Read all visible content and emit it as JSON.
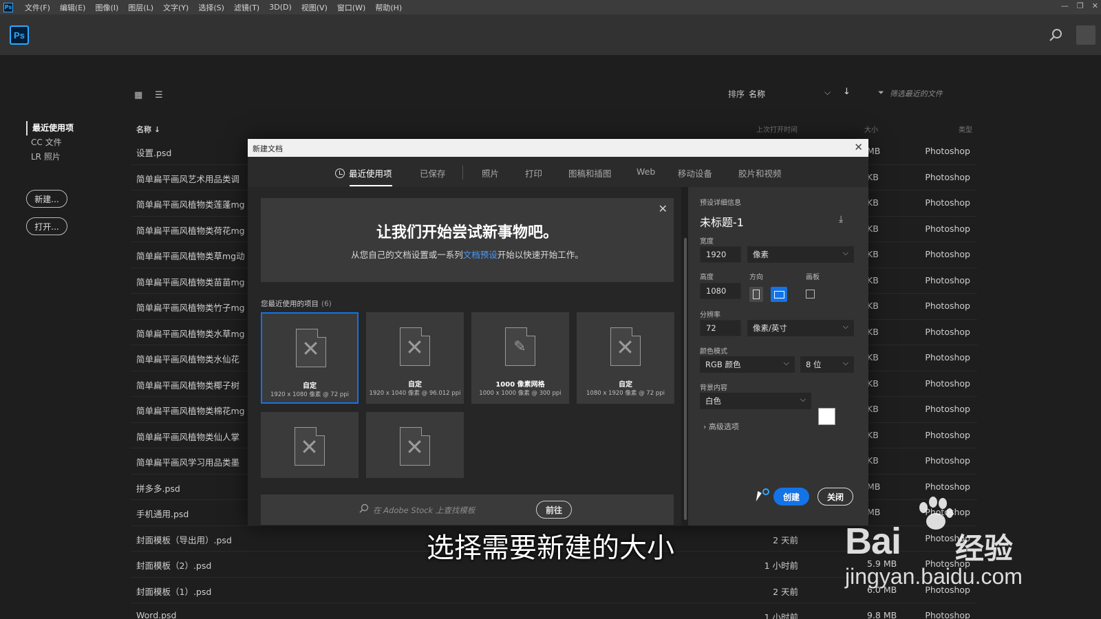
{
  "menubar": {
    "ps_badge": "Ps",
    "items": [
      "文件(F)",
      "编辑(E)",
      "图像(I)",
      "图层(L)",
      "文字(Y)",
      "选择(S)",
      "滤镜(T)",
      "3D(D)",
      "视图(V)",
      "窗口(W)",
      "帮助(H)"
    ],
    "window_controls": [
      "—",
      "❐",
      "✕"
    ]
  },
  "header": {
    "logo": "Ps",
    "search_icon": "search-icon"
  },
  "sidebar": {
    "nav": [
      "最近使用项",
      "CC 文件",
      "LR 照片"
    ],
    "new_button": "新建...",
    "open_button": "打开..."
  },
  "toolbar": {
    "grid_view_icon": "▦",
    "list_view_icon": "☰",
    "sort_label": "排序",
    "sort_value": "名称",
    "sort_chevron": "⌵",
    "sort_direction": "↓",
    "filter_icon": "⏷",
    "filter_placeholder": "筛选最近的文件"
  },
  "columns": {
    "name": "名称 ↓",
    "last_opened": "上次打开时间",
    "size": "大小",
    "type": "类型"
  },
  "files": [
    {
      "name": "设置.psd",
      "time": "",
      "size": "MB",
      "type": "Photoshop"
    },
    {
      "name": "简单扁平画风艺术用品类调",
      "time": "",
      "size": "KB",
      "type": "Photoshop"
    },
    {
      "name": "简单扁平画风植物类莲蓬mg",
      "time": "",
      "size": "KB",
      "type": "Photoshop"
    },
    {
      "name": "简单扁平画风植物类荷花mg",
      "time": "",
      "size": "KB",
      "type": "Photoshop"
    },
    {
      "name": "简单扁平画风植物类草mg动",
      "time": "",
      "size": "KB",
      "type": "Photoshop"
    },
    {
      "name": "简单扁平画风植物类苗苗mg",
      "time": "",
      "size": "KB",
      "type": "Photoshop"
    },
    {
      "name": "简单扁平画风植物类竹子mg",
      "time": "",
      "size": "KB",
      "type": "Photoshop"
    },
    {
      "name": "简单扁平画风植物类水草mg",
      "time": "",
      "size": "KB",
      "type": "Photoshop"
    },
    {
      "name": "简单扁平画风植物类水仙花",
      "time": "",
      "size": "KB",
      "type": "Photoshop"
    },
    {
      "name": "简单扁平画风植物类椰子树",
      "time": "",
      "size": "KB",
      "type": "Photoshop"
    },
    {
      "name": "简单扁平画风植物类棉花mg",
      "time": "",
      "size": "KB",
      "type": "Photoshop"
    },
    {
      "name": "简单扁平画风植物类仙人掌",
      "time": "",
      "size": "KB",
      "type": "Photoshop"
    },
    {
      "name": "简单扁平画风学习用品类墨",
      "time": "",
      "size": "KB",
      "type": "Photoshop"
    },
    {
      "name": "拼多多.psd",
      "time": "",
      "size": "MB",
      "type": "Photoshop"
    },
    {
      "name": "手机通用.psd",
      "time": "",
      "size": "MB",
      "type": "Photoshop"
    },
    {
      "name": "封面模板（导出用）.psd",
      "time": "2 天前",
      "size": "",
      "type": "Photoshop"
    },
    {
      "name": "封面模板（2）.psd",
      "time": "1 小时前",
      "size": "5.9 MB",
      "type": "Photoshop"
    },
    {
      "name": "封面模板（1）.psd",
      "time": "2 天前",
      "size": "6.0 MB",
      "type": "Photoshop"
    },
    {
      "name": "Word.psd",
      "time": "1 小时前",
      "size": "9.8 MB",
      "type": "Photoshop"
    }
  ],
  "modal": {
    "title": "新建文档",
    "close": "✕",
    "tabs": [
      "最近使用项",
      "已保存",
      "照片",
      "打印",
      "图稿和插图",
      "Web",
      "移动设备",
      "胶片和视频"
    ],
    "welcome": {
      "close": "✕",
      "title": "让我们开始尝试新事物吧。",
      "sub_before": "从您自己的文档设置或一系列",
      "sub_link": "文档预设",
      "sub_after": "开始以快速开始工作。"
    },
    "recent_label": "您最近使用的项目",
    "recent_count": "(6)",
    "presets": [
      {
        "name": "自定",
        "meta": "1920 x 1080 像素 @ 72 ppi"
      },
      {
        "name": "自定",
        "meta": "1920 x 1040 像素 @ 96.012 ppi"
      },
      {
        "name": "1000 像素网格",
        "meta": "1000 x 1000 像素 @ 300 ppi"
      },
      {
        "name": "自定",
        "meta": "1080 x 1920 像素 @ 72 ppi"
      },
      {
        "name": "",
        "meta": ""
      },
      {
        "name": "",
        "meta": ""
      }
    ],
    "stock": {
      "placeholder": "在 Adobe Stock 上查找模板",
      "go": "前往"
    },
    "details": {
      "header": "预设详细信息",
      "doc_name": "未标题-1",
      "width_label": "宽度",
      "width": "1920",
      "width_unit": "像素",
      "height_label": "高度",
      "height": "1080",
      "orientation_label": "方向",
      "artboard_label": "画板",
      "resolution_label": "分辨率",
      "resolution": "72",
      "resolution_unit": "像素/英寸",
      "color_mode_label": "颜色模式",
      "color_mode": "RGB 颜色",
      "bit_depth": "8 位",
      "background_label": "背景内容",
      "background": "白色",
      "background_color": "#ffffff",
      "advanced": "› 高级选项",
      "create": "创建",
      "close": "关闭"
    }
  },
  "overlay": {
    "subtitle": "选择需要新建的大小",
    "watermark_brand": "Bai",
    "watermark_cn": "经验",
    "watermark_url": "jingyan.baidu.com"
  },
  "colors": {
    "accent": "#1473e6",
    "ps_blue": "#31a8ff",
    "link": "#4a9bff"
  }
}
